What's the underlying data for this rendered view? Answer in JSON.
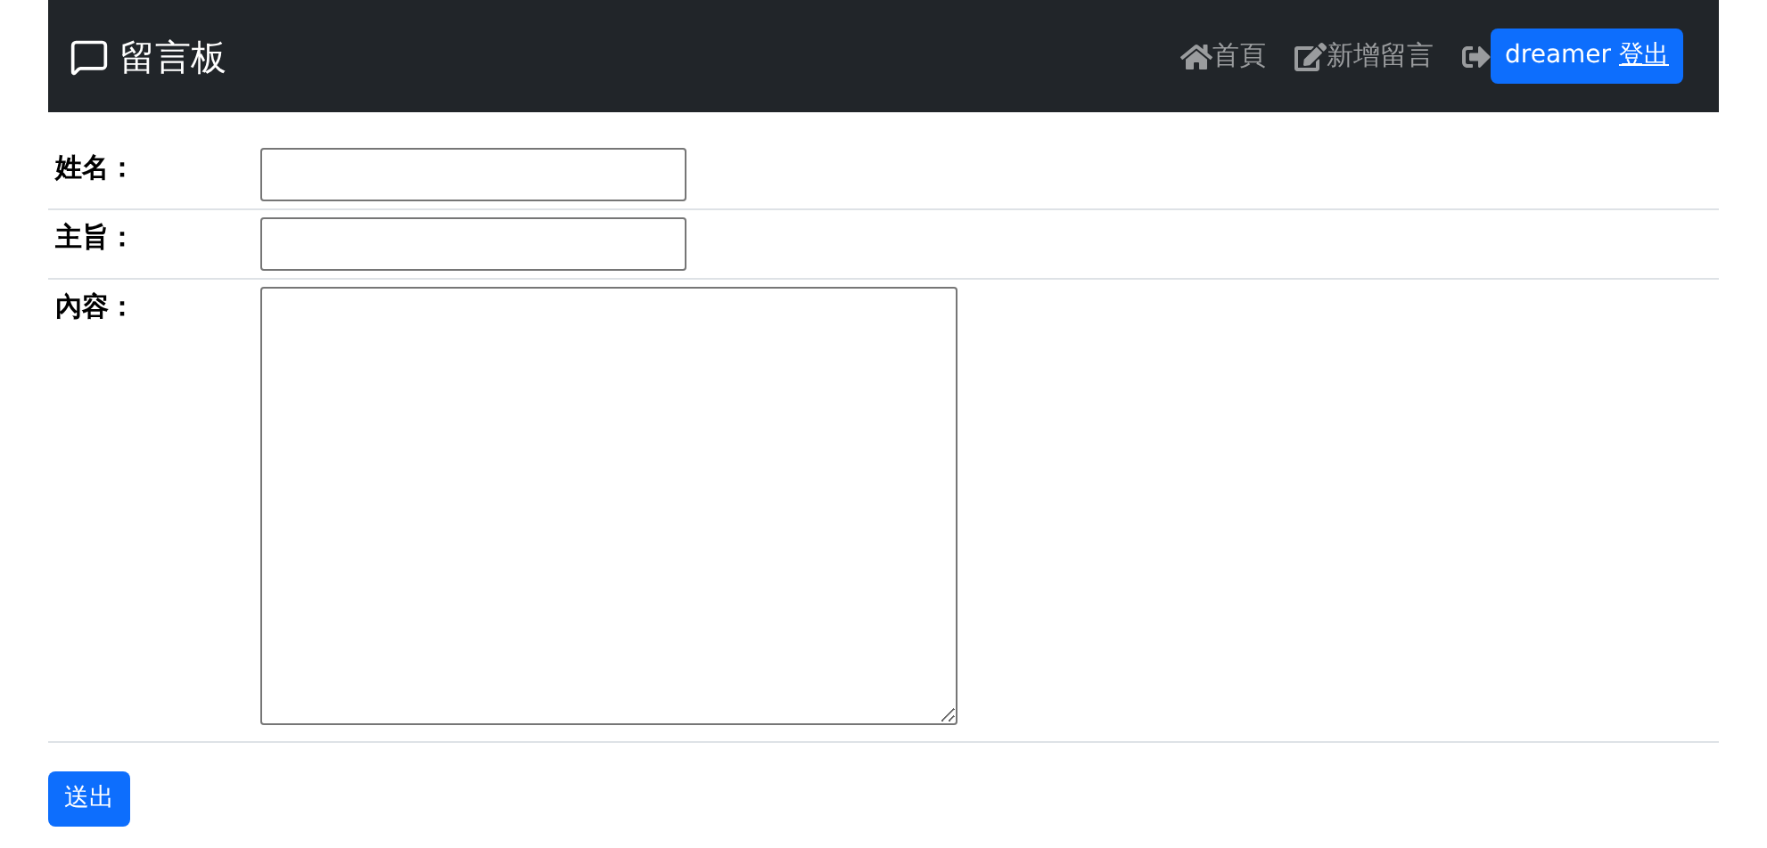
{
  "navbar": {
    "brand": "留言板",
    "links": [
      {
        "kind": "home",
        "label": "首頁"
      },
      {
        "kind": "edit",
        "label": "新增留言"
      }
    ],
    "logout": {
      "user": "dreamer",
      "label": "登出"
    }
  },
  "form": {
    "fields": [
      {
        "kind": "input",
        "label": "姓名："
      },
      {
        "kind": "input",
        "label": "主旨："
      },
      {
        "kind": "textarea",
        "label": "內容："
      }
    ],
    "submit": "送出"
  }
}
